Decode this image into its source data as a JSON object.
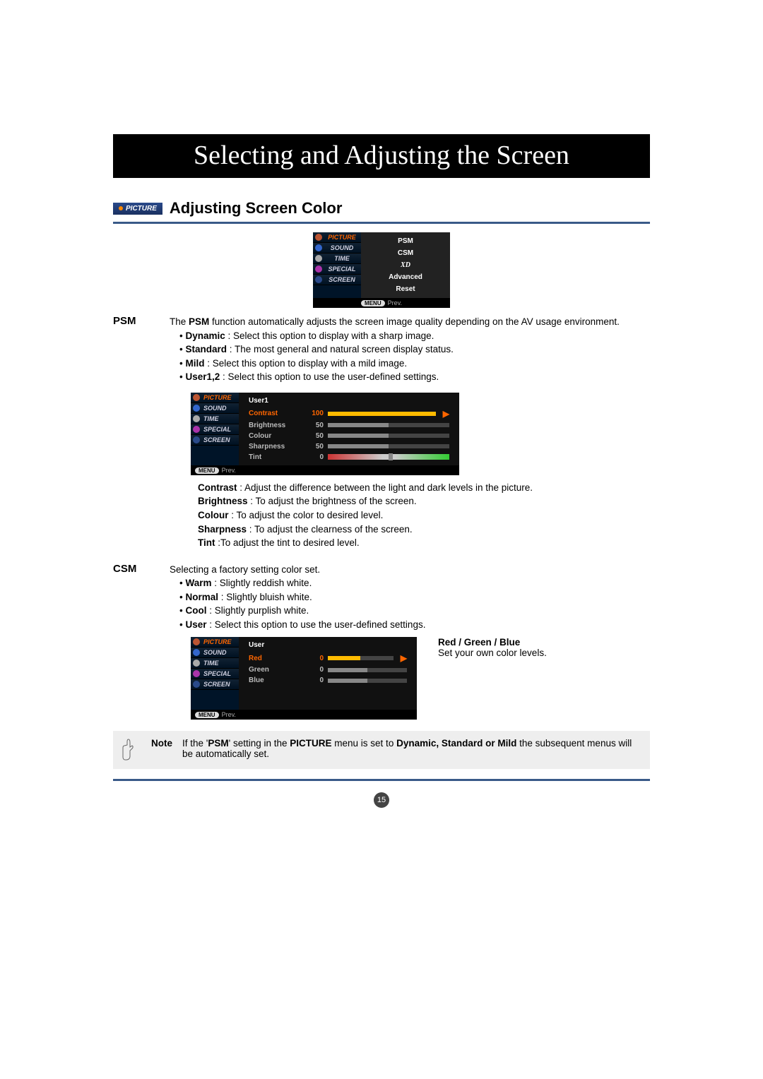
{
  "banner": "Selecting and Adjusting the Screen",
  "picture_tag": "PICTURE",
  "section_title": "Adjusting Screen Color",
  "osd_nav": {
    "items": [
      "PICTURE",
      "SOUND",
      "TIME",
      "SPECIAL",
      "SCREEN"
    ],
    "foot_menu": "MENU",
    "foot_prev": "Prev."
  },
  "osd1_body": [
    "PSM",
    "CSM",
    "XD",
    "Advanced",
    "Reset"
  ],
  "psm": {
    "label": "PSM",
    "intro_1": "The ",
    "intro_bold": "PSM",
    "intro_2": " function automatically adjusts the screen image quality depending on the AV usage environment.",
    "opts": [
      {
        "b": "Dynamic",
        "t": " : Select this option to display with a sharp image."
      },
      {
        "b": "Standard",
        "t": " : The most general and natural screen display status."
      },
      {
        "b": "Mild",
        "t": " : Select this option to display with a mild image."
      },
      {
        "b": "User1,2",
        "t": " : Select this option to use the user-defined settings."
      }
    ]
  },
  "osd2": {
    "title": "User1",
    "rows": [
      {
        "label": "Contrast",
        "value": "100",
        "fill": 100,
        "sel": true
      },
      {
        "label": "Brightness",
        "value": "50",
        "fill": 50
      },
      {
        "label": "Colour",
        "value": "50",
        "fill": 50
      },
      {
        "label": "Sharpness",
        "value": "50",
        "fill": 50
      }
    ],
    "tint": {
      "label": "Tint",
      "value": "0"
    }
  },
  "defs": [
    {
      "b": "Contrast",
      "t": " : Adjust the difference between the light and dark levels in the picture."
    },
    {
      "b": "Brightness",
      "t": " : To adjust the brightness of the screen."
    },
    {
      "b": "Colour",
      "t": " : To adjust the color to desired level."
    },
    {
      "b": "Sharpness",
      "t": " : To adjust the clearness of the screen."
    },
    {
      "b": "Tint",
      "t": " :To adjust the tint to desired level."
    }
  ],
  "csm": {
    "label": "CSM",
    "intro": "Selecting a factory setting color set.",
    "opts": [
      {
        "b": "Warm",
        "t": " : Slightly reddish white."
      },
      {
        "b": "Normal",
        "t": " : Slightly bluish white."
      },
      {
        "b": "Cool",
        "t": " : Slightly purplish white."
      },
      {
        "b": "User",
        "t": " : Select this option to use the user-defined settings."
      }
    ]
  },
  "osd3": {
    "title": "User",
    "rows": [
      {
        "label": "Red",
        "value": "0",
        "fill": 50,
        "sel": true
      },
      {
        "label": "Green",
        "value": "0",
        "fill": 50
      },
      {
        "label": "Blue",
        "value": "0",
        "fill": 50
      }
    ]
  },
  "rgb": {
    "title": "Red / Green / Blue",
    "text": "Set your own color levels."
  },
  "note": {
    "label": "Note",
    "t1": "If the '",
    "t2": "PSM",
    "t3": "' setting in the ",
    "t4": "PICTURE",
    "t5": " menu is set to ",
    "t6": "Dynamic, Standard or Mild",
    "t7": " the subsequent menus will be automatically set."
  },
  "page_number": "15"
}
